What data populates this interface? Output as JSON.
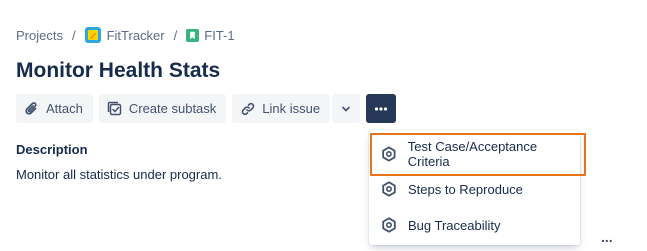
{
  "breadcrumb": {
    "projects": "Projects",
    "separator": "/",
    "project": "FitTracker",
    "project_icon": "project-avatar-icon",
    "issue_key": "FIT-1",
    "issue_icon": "story-icon"
  },
  "issue": {
    "title": "Monitor Health Stats"
  },
  "toolbar": {
    "attach_label": "Attach",
    "create_subtask_label": "Create subtask",
    "link_issue_label": "Link issue",
    "more_label": "•••"
  },
  "description": {
    "label": "Description",
    "text": "Monitor all statistics under program."
  },
  "more_menu": {
    "items": [
      {
        "label": "Test Case/Acceptance Criteria",
        "icon": "hexagon-icon",
        "highlighted": true
      },
      {
        "label": "Steps to Reproduce",
        "icon": "hexagon-icon"
      },
      {
        "label": "Bug Traceability",
        "icon": "hexagon-icon"
      }
    ]
  },
  "footer": {
    "more_actions": "..."
  },
  "colors": {
    "highlight_border": "#e8731b",
    "more_button_bg": "#253858",
    "project_icon": "#2ea7e0",
    "story_icon": "#36b37e"
  }
}
